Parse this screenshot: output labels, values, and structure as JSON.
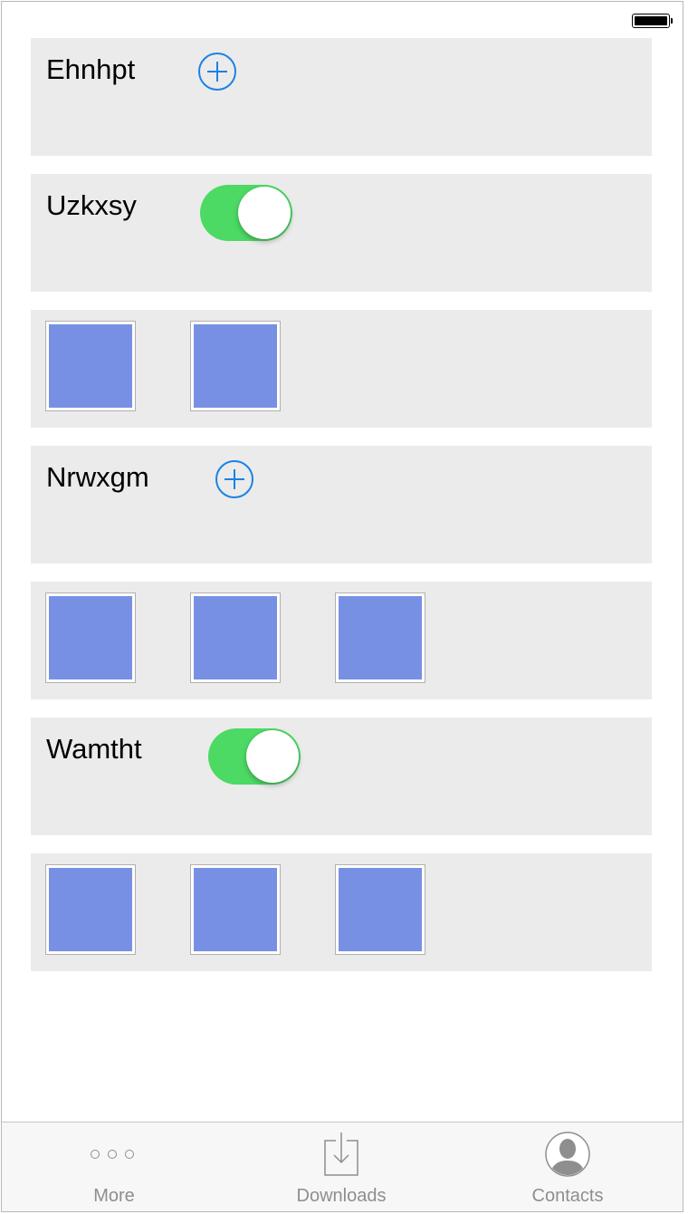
{
  "status_bar": {
    "battery_icon": "battery-full-icon"
  },
  "rows": [
    {
      "type": "label-add",
      "label": "Ehnhpt",
      "icon": "plus-circle-icon"
    },
    {
      "type": "label-toggle",
      "label": "Uzkxsy",
      "toggle_on": true
    },
    {
      "type": "thumbnails",
      "count": 2
    },
    {
      "type": "label-add",
      "label": "Nrwxgm",
      "icon": "plus-circle-icon"
    },
    {
      "type": "thumbnails",
      "count": 3
    },
    {
      "type": "label-toggle",
      "label": "Wamtht",
      "toggle_on": true
    },
    {
      "type": "thumbnails",
      "count": 3
    }
  ],
  "tab_bar": {
    "tabs": [
      {
        "label": "More",
        "icon": "more-icon"
      },
      {
        "label": "Downloads",
        "icon": "download-icon"
      },
      {
        "label": "Contacts",
        "icon": "contact-icon"
      }
    ]
  },
  "colors": {
    "row_background": "#ebebeb",
    "accent_blue": "#1a82e6",
    "toggle_green": "#4cd964",
    "thumbnail_fill": "#7890e4",
    "tab_label": "#8e8e8e"
  }
}
